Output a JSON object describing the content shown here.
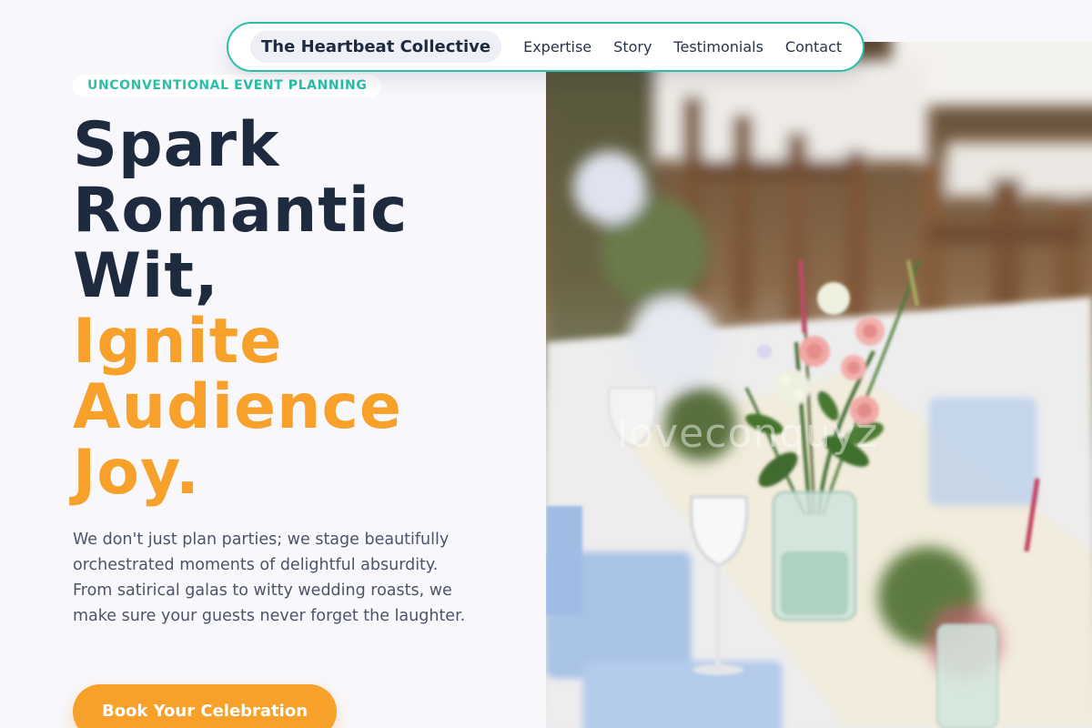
{
  "nav": {
    "brand": "The Heartbeat Collective",
    "links": [
      "Expertise",
      "Story",
      "Testimonials",
      "Contact"
    ]
  },
  "hero": {
    "eyebrow": "UNCONVENTIONAL EVENT PLANNING",
    "headline_dark": [
      "Spark",
      "Romantic",
      "Wit,"
    ],
    "headline_accent": [
      "Ignite",
      "Audience",
      "Joy."
    ],
    "description": "We don't just plan parties; we stage beautifully orchestrated moments of delightful absurdity. From satirical galas to witty wedding roasts, we make sure your guests never forget the laughter.",
    "cta_label": "Book Your Celebration"
  },
  "photo": {
    "subject": "wedding table with flower arrangements and glassware",
    "watermark": "loveconquyz"
  },
  "colors": {
    "accent_orange": "#f7a02a",
    "accent_teal": "#2bbfaa",
    "heading_dark": "#1e2a3e",
    "body_text": "#4c5567",
    "background": "#f8f7fc"
  }
}
